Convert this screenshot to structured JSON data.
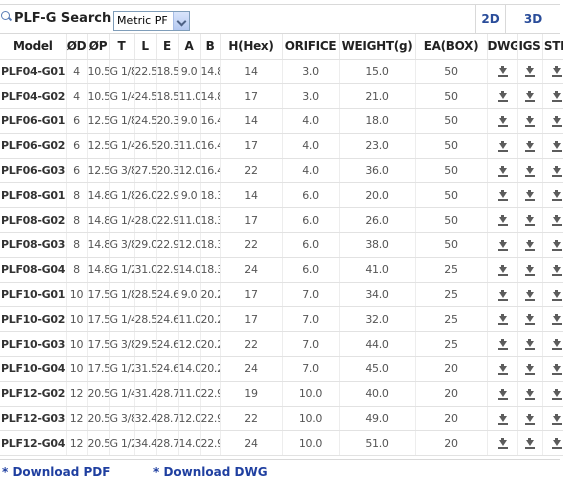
{
  "search": {
    "label": "PLF-G Search",
    "selected_unit": "Metric PF"
  },
  "tabs": {
    "tab_2d": "2D",
    "tab_3d": "3D"
  },
  "columns": [
    "Model",
    "ØD",
    "ØP",
    "T",
    "L",
    "E",
    "A",
    "B",
    "H(Hex)",
    "ORIFICE",
    "WEIGHT(g)",
    "EA(BOX)",
    "DWG",
    "IGS",
    "STP"
  ],
  "rows": [
    [
      "PLF04-G01",
      "4",
      "10.5",
      "G 1/8",
      "22.5",
      "18.5",
      "9.0",
      "14.8",
      "14",
      "3.0",
      "15.0",
      "50"
    ],
    [
      "PLF04-G02",
      "4",
      "10.5",
      "G 1/4",
      "24.5",
      "18.5",
      "11.0",
      "14.8",
      "17",
      "3.0",
      "21.0",
      "50"
    ],
    [
      "PLF06-G01",
      "6",
      "12.5",
      "G 1/8",
      "24.5",
      "20.3",
      "9.0",
      "16.4",
      "14",
      "4.0",
      "18.0",
      "50"
    ],
    [
      "PLF06-G02",
      "6",
      "12.5",
      "G 1/4",
      "26.5",
      "20.3",
      "11.0",
      "16.4",
      "17",
      "4.0",
      "23.0",
      "50"
    ],
    [
      "PLF06-G03",
      "6",
      "12.5",
      "G 3/8",
      "27.5",
      "20.3",
      "12.0",
      "16.4",
      "22",
      "4.0",
      "36.0",
      "50"
    ],
    [
      "PLF08-G01",
      "8",
      "14.8",
      "G 1/8",
      "26.0",
      "22.9",
      "9.0",
      "18.3",
      "14",
      "6.0",
      "20.0",
      "50"
    ],
    [
      "PLF08-G02",
      "8",
      "14.8",
      "G 1/4",
      "28.0",
      "22.9",
      "11.0",
      "18.3",
      "17",
      "6.0",
      "26.0",
      "50"
    ],
    [
      "PLF08-G03",
      "8",
      "14.8",
      "G 3/8",
      "29.0",
      "22.9",
      "12.0",
      "18.3",
      "22",
      "6.0",
      "38.0",
      "50"
    ],
    [
      "PLF08-G04",
      "8",
      "14.8",
      "G 1/2",
      "31.0",
      "22.9",
      "14.0",
      "18.3",
      "24",
      "6.0",
      "41.0",
      "25"
    ],
    [
      "PLF10-G01",
      "10",
      "17.5",
      "G 1/8",
      "28.5",
      "24.6",
      "9.0",
      "20.2",
      "17",
      "7.0",
      "34.0",
      "25"
    ],
    [
      "PLF10-G02",
      "10",
      "17.5",
      "G 1/4",
      "28.5",
      "24.6",
      "11.0",
      "20.2",
      "17",
      "7.0",
      "32.0",
      "25"
    ],
    [
      "PLF10-G03",
      "10",
      "17.5",
      "G 3/8",
      "29.5",
      "24.6",
      "12.0",
      "20.2",
      "22",
      "7.0",
      "44.0",
      "25"
    ],
    [
      "PLF10-G04",
      "10",
      "17.5",
      "G 1/2",
      "31.5",
      "24.6",
      "14.0",
      "20.2",
      "24",
      "7.0",
      "45.0",
      "20"
    ],
    [
      "PLF12-G02",
      "12",
      "20.5",
      "G 1/4",
      "31.4",
      "28.7",
      "11.0",
      "22.9",
      "19",
      "10.0",
      "40.0",
      "20"
    ],
    [
      "PLF12-G03",
      "12",
      "20.5",
      "G 3/8",
      "32.4",
      "28.7",
      "12.0",
      "22.9",
      "22",
      "10.0",
      "49.0",
      "20"
    ],
    [
      "PLF12-G04",
      "12",
      "20.5",
      "G 1/2",
      "34.4",
      "28.7",
      "14.0",
      "22.9",
      "24",
      "10.0",
      "51.0",
      "20"
    ]
  ],
  "footer": {
    "download_pdf": "* Download PDF",
    "download_dwg": "* Download DWG"
  },
  "icons": {
    "download": "download-icon"
  }
}
